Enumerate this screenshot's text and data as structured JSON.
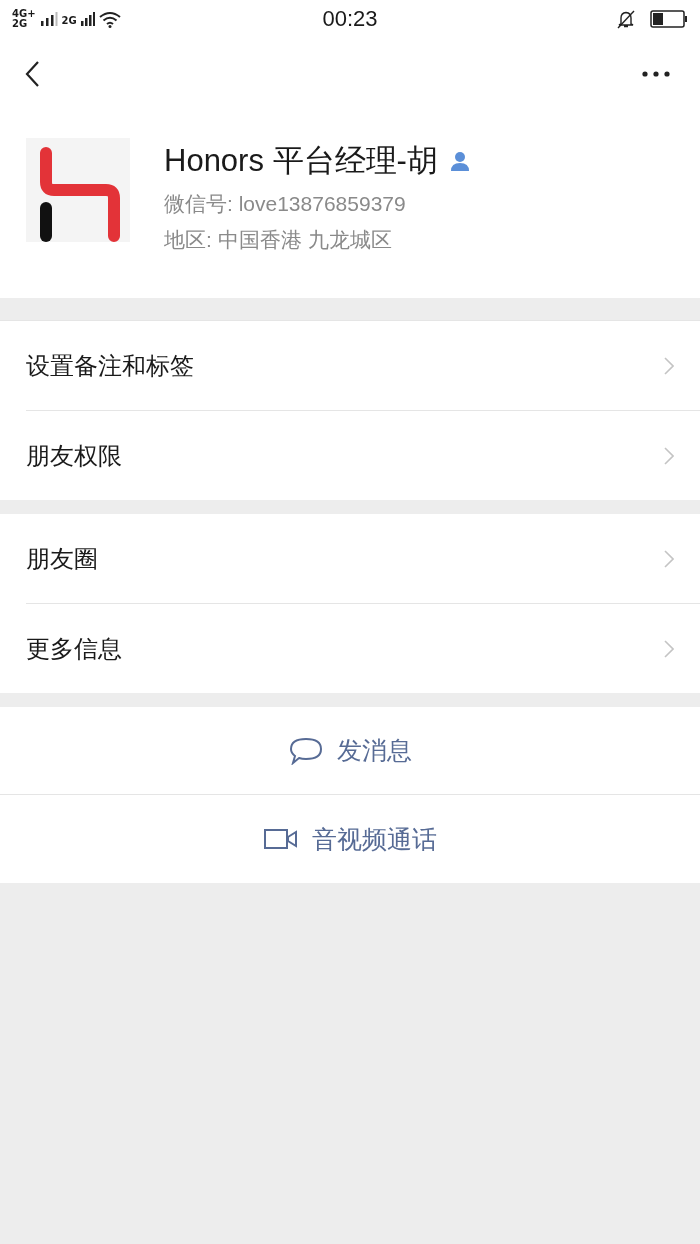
{
  "status_bar": {
    "network_labels": [
      "4G+",
      "2G",
      "2G"
    ],
    "time": "00:23"
  },
  "profile": {
    "name": "Honors 平台经理-胡",
    "wechat_id": "微信号: love13876859379",
    "region": "地区: 中国香港  九龙城区"
  },
  "menu_groups": [
    {
      "items": [
        {
          "label": "设置备注和标签"
        },
        {
          "label": "朋友权限"
        }
      ]
    },
    {
      "items": [
        {
          "label": "朋友圈"
        },
        {
          "label": "更多信息"
        }
      ]
    }
  ],
  "actions": [
    {
      "kind": "message",
      "label": "发消息"
    },
    {
      "kind": "call",
      "label": "音视频通话"
    }
  ]
}
